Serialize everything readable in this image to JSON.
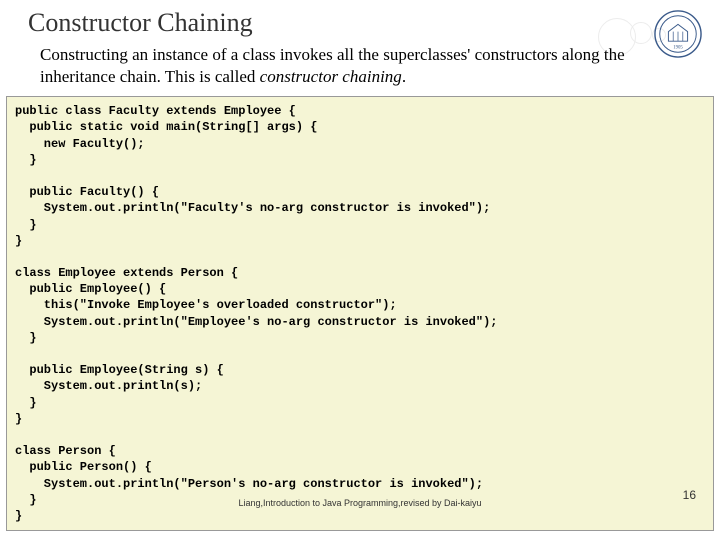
{
  "slide": {
    "title": "Constructor Chaining",
    "description_part1": "Constructing an instance of a class invokes all the superclasses' constructors along the inheritance chain. This is called ",
    "description_italic": "constructor chaining",
    "description_part2": ".",
    "code": "public class Faculty extends Employee {\n  public static void main(String[] args) {\n    new Faculty();\n  }\n\n  public Faculty() {\n    System.out.println(\"Faculty's no-arg constructor is invoked\");\n  }\n}\n\nclass Employee extends Person {\n  public Employee() {\n    this(\"Invoke Employee's overloaded constructor\");\n    System.out.println(\"Employee's no-arg constructor is invoked\");\n  }\n\n  public Employee(String s) {\n    System.out.println(s);\n  }\n}\n\nclass Person {\n  public Person() {\n    System.out.println(\"Person's no-arg constructor is invoked\");\n  }\n}",
    "footer_credit": "Liang,Introduction to Java Programming,revised by Dai-kaiyu",
    "page_number": "16",
    "logo_year": "1905"
  }
}
